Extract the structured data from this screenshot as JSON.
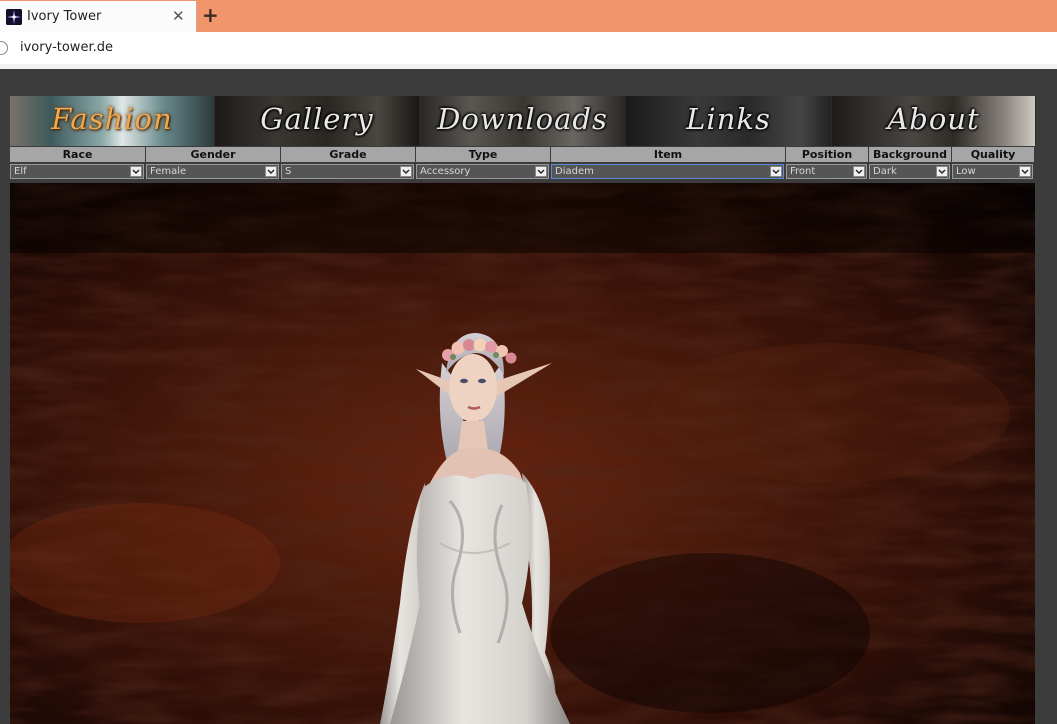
{
  "browser": {
    "tab_title": "Ivory Tower",
    "tab_close": "✕",
    "new_tab": "+",
    "address": "ivory-tower.de"
  },
  "nav": [
    {
      "label": "Fashion",
      "active": true
    },
    {
      "label": "Gallery",
      "active": false
    },
    {
      "label": "Downloads",
      "active": false
    },
    {
      "label": "Links",
      "active": false
    },
    {
      "label": "About",
      "active": false
    }
  ],
  "filters": [
    {
      "header": "Race",
      "value": "Elf"
    },
    {
      "header": "Gender",
      "value": "Female"
    },
    {
      "header": "Grade",
      "value": "S"
    },
    {
      "header": "Type",
      "value": "Accessory"
    },
    {
      "header": "Item",
      "value": "Diadem"
    },
    {
      "header": "Position",
      "value": "Front"
    },
    {
      "header": "Background",
      "value": "Dark"
    },
    {
      "header": "Quality",
      "value": "Low"
    }
  ],
  "colors": {
    "titlebar": "#f0956c",
    "page_bg": "#3c3c3c",
    "active_nav": "#f0a84c",
    "filter_header": "#a6a6a6",
    "filter_select": "#555555"
  }
}
